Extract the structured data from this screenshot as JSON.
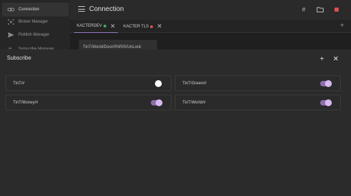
{
  "sidebar": {
    "items": [
      {
        "label": "Connection",
        "icon": "link-icon"
      },
      {
        "label": "Broker Manager",
        "icon": "broker-icon"
      },
      {
        "label": "Publish Manager",
        "icon": "send-icon"
      },
      {
        "label": "Subscribe Manager",
        "icon": "subscribe-icon"
      }
    ]
  },
  "header": {
    "title": "Connection"
  },
  "tabs": [
    {
      "label": "KACTERDEV",
      "status_color": "#3bb36b"
    },
    {
      "label": "KACTER TLS",
      "status_color": "#e05050"
    }
  ],
  "background": {
    "topic": "TinT/World/Door/PARIS/UnLock"
  },
  "subscribe": {
    "title": "Subscribe",
    "items": [
      {
        "topic": "TinT/#",
        "enabled": false
      },
      {
        "topic": "TinT/Green/#",
        "enabled": true
      },
      {
        "topic": "TinT/Money/#",
        "enabled": true
      },
      {
        "topic": "TinT/World/#",
        "enabled": true
      }
    ]
  },
  "colors": {
    "accent": "#9c7bd1",
    "toggle_on": "#8d6fa6",
    "knob_on": "#d7b9f2",
    "stop": "#e05050"
  }
}
